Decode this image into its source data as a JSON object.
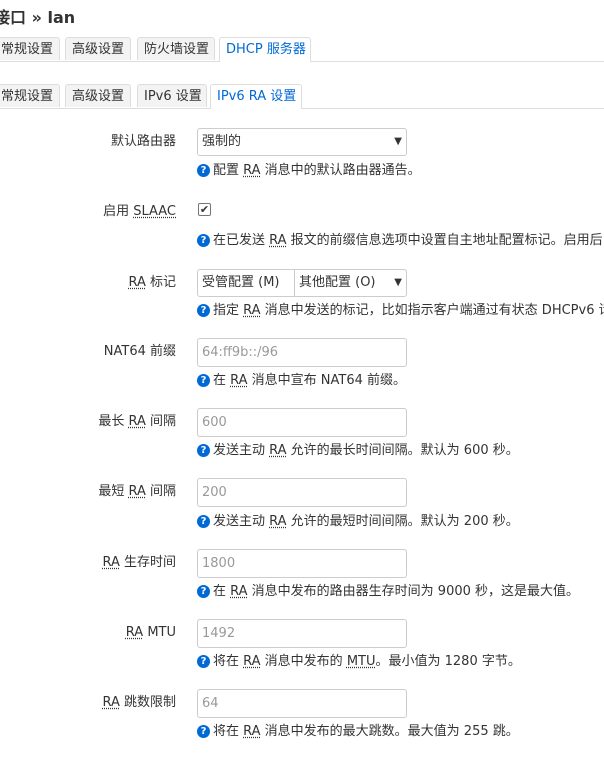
{
  "page": {
    "title": "接口 » lan"
  },
  "main_tabs": [
    "常规设置",
    "高级设置",
    "防火墙设置",
    "DHCP 服务器"
  ],
  "sub_tabs": [
    "常规设置",
    "高级设置",
    "IPv6 设置",
    "IPv6 RA 设置"
  ],
  "fields": {
    "default_router": {
      "label": "默认路由器",
      "value": "强制的",
      "help_pre": "配置 ",
      "help_abbr": "RA",
      "help_post": " 消息中的默认路由器通告。"
    },
    "slaac": {
      "label_pre": "启用 ",
      "label_abbr": "SLAAC",
      "checked": "✔",
      "help_pre": "在已发送 ",
      "help_abbr": "RA",
      "help_post": " 报文的前缀信息选项中设置自主地址配置标记。启用后"
    },
    "ra_flags": {
      "label_abbr": "RA",
      "label_post": " 标记",
      "option1": "受管配置 (M)",
      "option2": "其他配置 (O)",
      "help_pre": "指定 ",
      "help_abbr": "RA",
      "help_post": " 消息中发送的标记，比如指示客户端通过有状态 DHCPv6 请"
    },
    "nat64": {
      "label": "NAT64 前缀",
      "placeholder": "64:ff9b::/96",
      "help_pre": "在 ",
      "help_abbr": "RA",
      "help_post": " 消息中宣布 NAT64 前缀。"
    },
    "max_interval": {
      "label_pre": "最长 ",
      "label_abbr": "RA",
      "label_post": " 间隔",
      "placeholder": "600",
      "help_pre": "发送主动 ",
      "help_abbr": "RA",
      "help_post": " 允许的最长时间间隔。默认为 600 秒。"
    },
    "min_interval": {
      "label_pre": "最短 ",
      "label_abbr": "RA",
      "label_post": " 间隔",
      "placeholder": "200",
      "help_pre": "发送主动 ",
      "help_abbr": "RA",
      "help_post": " 允许的最短时间间隔。默认为 200 秒。"
    },
    "lifetime": {
      "label_abbr": "RA",
      "label_post": " 生存时间",
      "placeholder": "1800",
      "help_pre": "在 ",
      "help_abbr": "RA",
      "help_post": " 消息中发布的路由器生存时间为 9000 秒，这是最大值。"
    },
    "mtu": {
      "label_abbr": "RA",
      "label_post": " MTU",
      "placeholder": "1492",
      "help_pre": "将在 ",
      "help_abbr": "RA",
      "help_mid": " 消息中发布的 ",
      "help_abbr2": "MTU",
      "help_post": "。最小值为 1280 字节。"
    },
    "hop_limit": {
      "label_abbr": "RA",
      "label_post": " 跳数限制",
      "placeholder": "64",
      "help_pre": "将在 ",
      "help_abbr": "RA",
      "help_post": " 消息中发布的最大跳数。最大值为 255 跳。"
    }
  },
  "help_icon": {
    "glyph": "?",
    "name": "question-icon",
    "color": "#0069d6"
  },
  "dropdown_icon": {
    "glyph": "▼",
    "name": "chevron-down-icon"
  }
}
